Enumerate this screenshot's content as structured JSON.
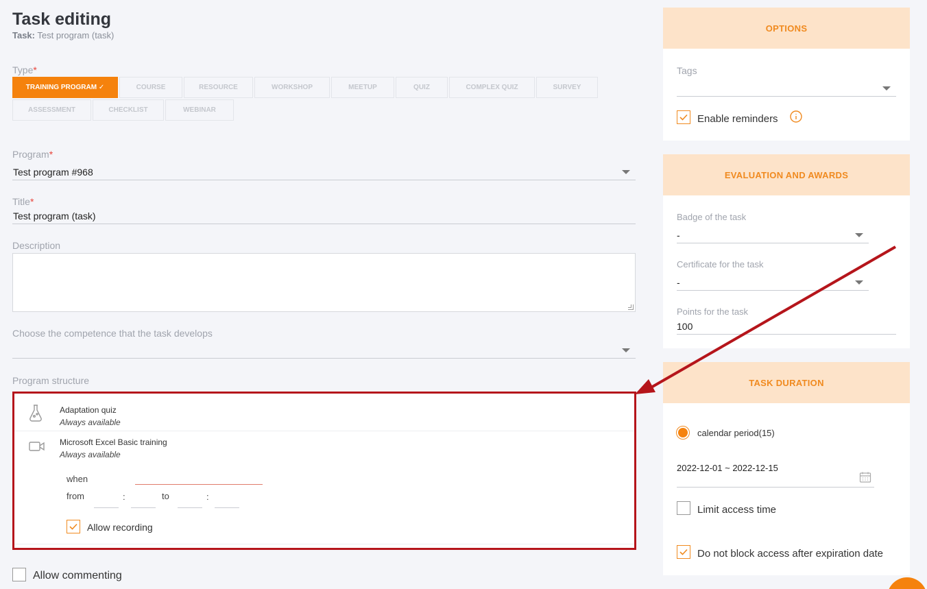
{
  "header": {
    "title": "Task editing",
    "sub_label": "Task:",
    "sub_value": "Test program (task)"
  },
  "type": {
    "label": "Type",
    "required_mark": "*",
    "row1": [
      "TRAINING PROGRAM ✓",
      "COURSE",
      "RESOURCE",
      "WORKSHOP",
      "MEETUP",
      "QUIZ",
      "COMPLEX QUIZ",
      "SURVEY"
    ],
    "row2": [
      "ASSESSMENT",
      "CHECKLIST",
      "WEBINAR"
    ]
  },
  "program": {
    "label": "Program",
    "value": "Test program #968"
  },
  "title": {
    "label": "Title",
    "value": "Test program (task)"
  },
  "description": {
    "label": "Description",
    "value": ""
  },
  "competence": {
    "label": "Choose the competence that the task develops",
    "value": ""
  },
  "structure": {
    "label": "Program structure",
    "items": [
      {
        "title": "Adaptation quiz",
        "sub": "Always available",
        "icon": "flask-icon"
      },
      {
        "title": "Microsoft Excel Basic training",
        "sub": "Always available",
        "icon": "video-camera-icon"
      }
    ],
    "when_label": "when",
    "from_label": "from",
    "to_label": "to",
    "colon": ":",
    "allow_recording": "Allow recording"
  },
  "allow_commenting": "Allow commenting",
  "options": {
    "header": "OPTIONS",
    "tags_label": "Tags",
    "tags_value": "",
    "enable_reminders": "Enable reminders"
  },
  "evaluation": {
    "header": "EVALUATION AND AWARDS",
    "badge_label": "Badge of the task",
    "badge_value": "-",
    "certificate_label": "Certificate for the task",
    "certificate_value": "-",
    "points_label": "Points for the task",
    "points_value": "100"
  },
  "duration": {
    "header": "TASK DURATION",
    "calendar_period": "calendar period(15)",
    "date_range": "2022-12-01 ~ 2022-12-15",
    "limit_access": "Limit access time",
    "no_block": "Do not block access after expiration date"
  },
  "colors": {
    "accent": "#f5820d",
    "panel_head": "#fde3c9",
    "highlight": "#b5151b"
  }
}
